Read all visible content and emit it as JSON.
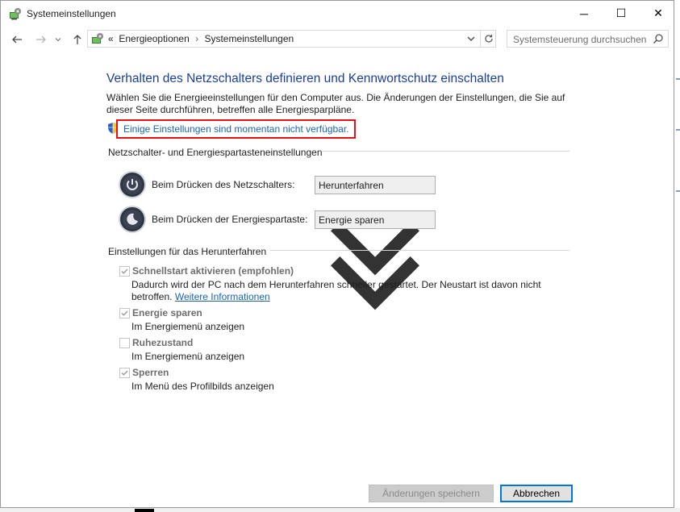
{
  "window": {
    "title": "Systemeinstellungen",
    "minimize_glyph": "─",
    "maximize_glyph": "☐",
    "close_glyph": "✕"
  },
  "nav": {
    "back_icon": "arrow-left-icon",
    "forward_icon": "arrow-right-icon",
    "recent_icon": "chevron-down-icon",
    "up_icon": "arrow-up-icon",
    "breadcrumb_prefix": "«",
    "breadcrumb": [
      "Energieoptionen",
      "Systemeinstellungen"
    ],
    "separator": "›",
    "search_placeholder": "Systemsteuerung durchsuchen"
  },
  "content": {
    "heading": "Verhalten des Netzschalters definieren und Kennwortschutz einschalten",
    "description": "Wählen Sie die Energieeinstellungen für den Computer aus. Die Änderungen der Einstellungen, die Sie auf dieser Seite durchführen, betreffen alle Energiesparpläne.",
    "unavailable_link": "Einige Einstellungen sind momentan nicht verfügbar.",
    "power_group": {
      "header": "Netzschalter- und Energiespartasteneinstellungen",
      "rows": [
        {
          "label": "Beim Drücken des Netzschalters:",
          "value": "Herunterfahren",
          "icon": "power-button-icon"
        },
        {
          "label": "Beim Drücken der Energiespartaste:",
          "value": "Energie sparen",
          "icon": "sleep-button-icon"
        }
      ]
    },
    "shutdown_group": {
      "header": "Einstellungen für das Herunterfahren",
      "items": [
        {
          "label": "Schnellstart aktivieren (empfohlen)",
          "checked": true,
          "desc_prefix": "Dadurch wird der PC nach dem Herunterfahren schneller gestartet. Der Neustart ist davon nicht betroffen.",
          "link": "Weitere Informationen"
        },
        {
          "label": "Energie sparen",
          "checked": true,
          "desc": "Im Energiemenü anzeigen"
        },
        {
          "label": "Ruhezustand",
          "checked": false,
          "desc": "Im Energiemenü anzeigen"
        },
        {
          "label": "Sperren",
          "checked": true,
          "desc": "Im Menü des Profilbilds anzeigen"
        }
      ]
    }
  },
  "buttons": {
    "save": "Änderungen speichern",
    "cancel": "Abbrechen"
  },
  "colors": {
    "heading": "#1a3e9e",
    "link": "#1a63b3",
    "highlight_border": "#e81010",
    "disabled_text": "#6d6d6d"
  }
}
